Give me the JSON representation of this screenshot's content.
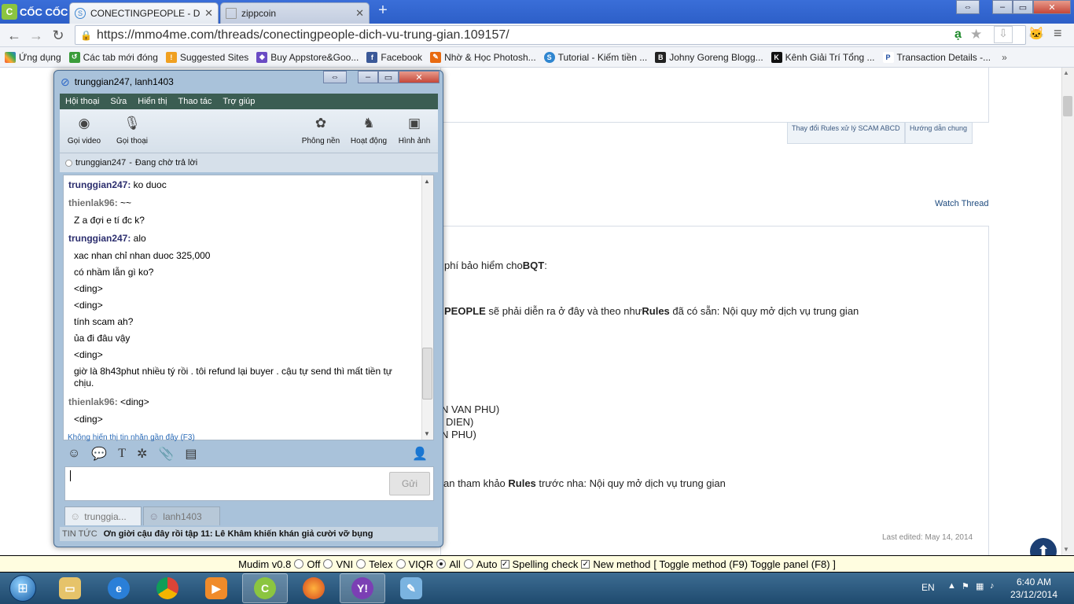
{
  "browser": {
    "logo": "CỐC CỐC",
    "tabs": [
      {
        "title": "CONECTINGPEOPLE - Dịch",
        "icon": "s-icon"
      },
      {
        "title": "zippcoin",
        "icon": "doc-icon"
      }
    ],
    "url": "https://mmo4me.com/threads/conectingpeople-dich-vu-trung-gian.109157/",
    "bookmarks": [
      "Ứng dụng",
      "Các tab mới đóng",
      "Suggested Sites",
      "Buy Appstore&Goo...",
      "Facebook",
      "Nhờ & Học Photosh...",
      "Tutorial - Kiếm tiền ...",
      "Johny Goreng Blogg...",
      "Kênh Giải Trí Tổng ...",
      "Transaction Details -..."
    ]
  },
  "page": {
    "nav_tabs": [
      "Thay đổi Rules xử lý SCAM ABCD",
      "Hướng dẫn chung"
    ],
    "watch_thread": "Watch Thread",
    "lines": {
      "l1": "phí bảo hiểm cho",
      "l1b": "BQT",
      "l1c": ":",
      "l2b": "PEOPLE",
      "l2": " sẽ phải diễn ra ở đây và theo như",
      "l2rules": "Rules",
      "l2c": " đã có sẵn: Nội quy mở dịch vụ trung gian",
      "l3": "N VAN PHU)",
      "l4": "DIEN)",
      "l5": "N PHU)",
      "l6": "an tham khảo ",
      "l6b": "Rules",
      "l6c": " trước nha: Nội quy mở dịch vụ trung gian"
    },
    "last_edited": "Last edited: May 14, 2014"
  },
  "messenger": {
    "title": "trunggian247, lanh1403",
    "menu": [
      "Hội thoại",
      "Sửa",
      "Hiển thị",
      "Thao tác",
      "Trợ giúp"
    ],
    "tools": [
      "Gọi video",
      "Gọi thoại",
      "Phông nền",
      "Hoạt động",
      "Hình ảnh"
    ],
    "status_user": "trunggian247",
    "status_text": "Đang chờ trả lời",
    "messages": [
      {
        "name": "trunggian247:",
        "text": " ko duoc"
      },
      {
        "name": "thienlak96:",
        "text": " ~~"
      },
      {
        "text": "Z a đợi e tí đc k?"
      },
      {
        "name": "trunggian247:",
        "text": " alo"
      },
      {
        "text": "xac nhan chỉ nhan duoc 325,000"
      },
      {
        "text": "có nhầm lẫn gì ko?"
      },
      {
        "text": "<ding>"
      },
      {
        "text": "<ding>"
      },
      {
        "text": "tính scam ah?"
      },
      {
        "text": "ủa đi đâu vậy"
      },
      {
        "text": "<ding>"
      },
      {
        "text": "giờ là 8h43phut nhiều tý rồi . tôi refund lại buyer . cậu tự send thì mất tiền tự chịu."
      },
      {
        "name": "thienlak96:",
        "text": " <ding>"
      },
      {
        "text": "<ding>"
      }
    ],
    "hint": "Không hiển thị tin nhắn gần đây (F3)",
    "send": "Gửi",
    "conv_tabs": [
      "trunggia...",
      "lanh1403"
    ],
    "news_label": "TIN TỨC",
    "news_text": "Ơn giời cậu đây rồi tập 11: Lê Khâm khiến khán giả cười vỡ bụng"
  },
  "mudim": {
    "name": "Mudim v0.8",
    "opts": [
      "Off",
      "VNI",
      "Telex",
      "VIQR",
      "All",
      "Auto"
    ],
    "spell": "Spelling check",
    "newm": "New method",
    "toggles": "[ Toggle method (F9) Toggle panel (F8) ]"
  },
  "taskbar": {
    "lang": "EN",
    "time": "6:40 AM",
    "date": "23/12/2014"
  }
}
